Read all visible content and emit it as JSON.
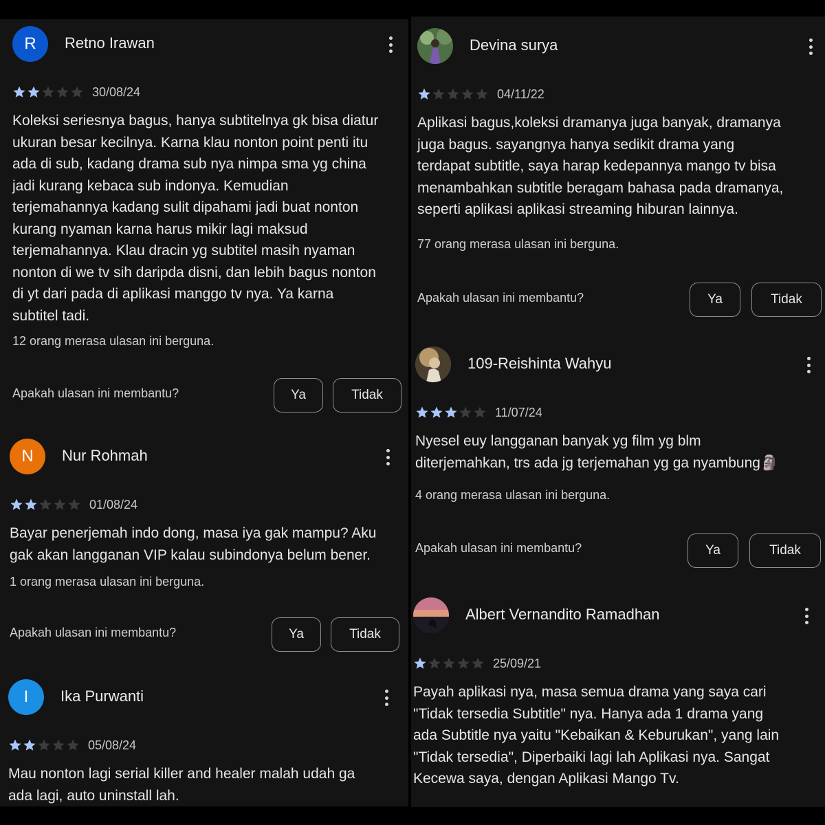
{
  "colors": {
    "star_filled": "#a8c7fa",
    "star_empty": "#3c3c3c",
    "avatar_R": "#0b57d0",
    "avatar_N": "#e8710a",
    "avatar_I": "#1a8fe3"
  },
  "icons": {
    "menu": "more-vert-icon",
    "star": "star-icon"
  },
  "left": [
    {
      "avatar_letter": "R",
      "name": "Retno Irawan",
      "stars": 2,
      "date": "30/08/24",
      "text": "Koleksi seriesnya bagus, hanya subtitelnya gk bisa diatur\nukuran besar kecilnya. Karna klau nonton point penti itu\nada di sub, kadang drama sub nya nimpa sma yg china\njadi kurang kebaca sub indonya. Kemudian\nterjemahannya kadang sulit dipahami jadi buat nonton\nkurang nyaman karna harus mikir lagi maksud\nterjemahannya. Klau dracin yg subtitel masih nyaman\nnonton di we tv sih daripda disni, dan lebih bagus nonton\ndi yt dari pada di aplikasi manggo tv nya. Ya karna\nsubtitel tadi.",
      "helpful": "12 orang merasa ulasan ini berguna.",
      "ask": "Apakah ulasan ini membantu?",
      "yes": "Ya",
      "no": "Tidak"
    },
    {
      "avatar_letter": "N",
      "name": "Nur Rohmah",
      "stars": 2,
      "date": "01/08/24",
      "text": "Bayar penerjemah indo dong, masa iya gak mampu? Aku\ngak akan langganan VIP kalau subindonya belum bener.",
      "helpful": "1 orang merasa ulasan ini berguna.",
      "ask": "Apakah ulasan ini membantu?",
      "yes": "Ya",
      "no": "Tidak"
    },
    {
      "avatar_letter": "I",
      "name": "Ika Purwanti",
      "stars": 2,
      "date": "05/08/24",
      "text": "Mau nonton lagi serial killer and healer malah udah ga\nada lagi, auto uninstall lah."
    }
  ],
  "right": [
    {
      "name": "Devina surya",
      "stars": 1,
      "date": "04/11/22",
      "text": "Aplikasi bagus,koleksi dramanya juga banyak, dramanya\njuga bagus. sayangnya hanya sedikit drama yang\nterdapat subtitle, saya harap kedepannya mango tv bisa\nmenambahkan subtitle beragam bahasa pada dramanya,\nseperti aplikasi aplikasi streaming hiburan lainnya.",
      "helpful": "77 orang merasa ulasan ini berguna.",
      "ask": "Apakah ulasan ini membantu?",
      "yes": "Ya",
      "no": "Tidak"
    },
    {
      "name": "109-Reishinta Wahyu",
      "stars": 3,
      "date": "11/07/24",
      "text": "Nyesel euy langganan banyak yg film yg blm\nditerjemahkan, trs ada jg terjemahan yg ga nyambung🗿",
      "helpful": "4 orang merasa ulasan ini berguna.",
      "ask": "Apakah ulasan ini membantu?",
      "yes": "Ya",
      "no": "Tidak"
    },
    {
      "name": "Albert Vernandito Ramadhan",
      "stars": 1,
      "date": "25/09/21",
      "text": "Payah aplikasi nya, masa semua drama yang saya cari\n\"Tidak tersedia Subtitle\" nya. Hanya ada 1 drama yang\nada Subtitle nya yaitu \"Kebaikan & Keburukan\", yang lain\n\"Tidak tersedia\", Diperbaiki lagi lah Aplikasi nya. Sangat\nKecewa saya, dengan Aplikasi Mango Tv."
    }
  ]
}
